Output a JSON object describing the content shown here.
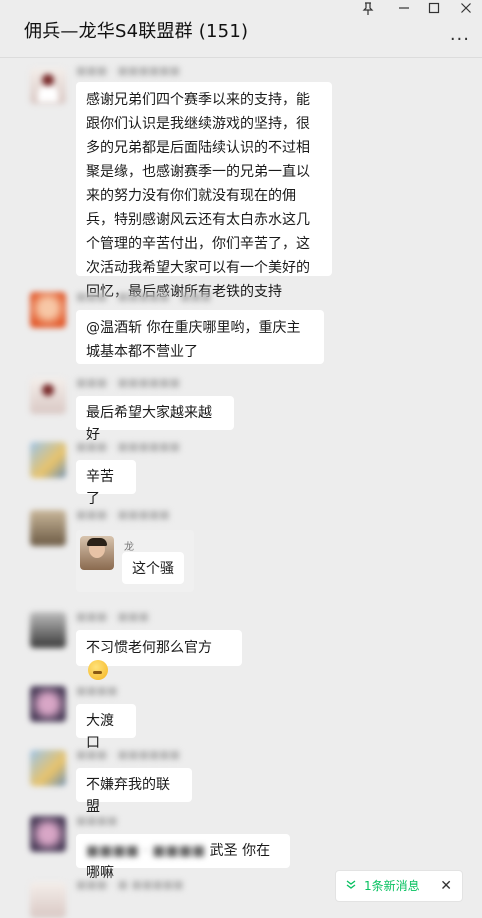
{
  "window": {
    "title": "佣兵—龙华S4联盟群 (151)",
    "controls": [
      "pin-icon",
      "minimize-icon",
      "maximize-icon",
      "close-icon"
    ],
    "more_label": "..."
  },
  "messages": [
    {
      "type": "text",
      "avatar": "avatar-1",
      "text": "感谢兄弟们四个赛季以来的支持，能跟你们认识是我继续游戏的坚持，很多的兄弟都是后面陆续认识的不过相聚是缘，也感谢赛季一的兄弟一直以来的努力没有你们就没有现在的佣兵，特别感谢风云还有太白赤水这几个管理的辛苦付出，你们辛苦了，这次活动我希望大家可以有一个美好的回忆，最后感谢所有老铁的支持"
    },
    {
      "type": "text",
      "avatar": "avatar-2",
      "text": "@温酒斩 你在重庆哪里哟，重庆主城基本都不营业了"
    },
    {
      "type": "text",
      "avatar": "avatar-1",
      "text": "最后希望大家越来越好"
    },
    {
      "type": "text",
      "avatar": "avatar-3",
      "text": "辛苦了"
    },
    {
      "type": "quote",
      "avatar": "avatar-4",
      "quote_name": "龙",
      "quote_text": "这个骚"
    },
    {
      "type": "text",
      "avatar": "avatar-5",
      "text": "不习惯老何那么官方",
      "emoji": "thinking-face-emoji"
    },
    {
      "type": "text",
      "avatar": "avatar-6",
      "text": "大渡口"
    },
    {
      "type": "text",
      "avatar": "avatar-3",
      "text": "不嫌弃我的联盟"
    },
    {
      "type": "text",
      "avatar": "avatar-6",
      "mention_prefix": "",
      "text": "武圣 你在哪嘛"
    }
  ],
  "new_message_notice": {
    "label": "1条新消息",
    "icon": "double-chevron-down-icon",
    "close_icon": "close-icon"
  },
  "colors": {
    "background": "#ededed",
    "bubble": "#ffffff",
    "notice_accent": "#07c160"
  }
}
